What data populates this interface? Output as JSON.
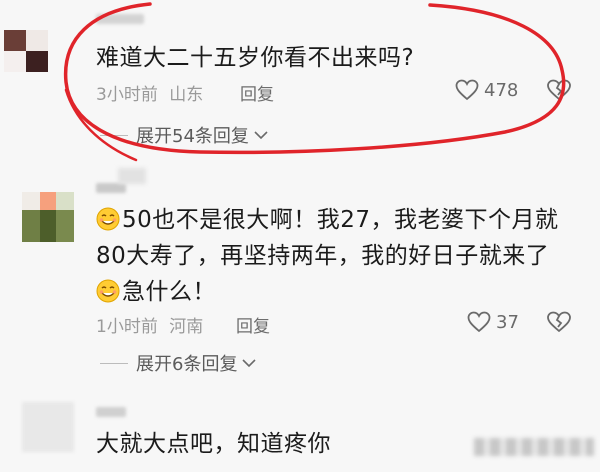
{
  "colors": {
    "background": "#f7f7f7",
    "annotation_circle": "#e0242a",
    "text": "#1b1b1b",
    "meta": "#9a9a9a"
  },
  "comments": [
    {
      "lines": [
        "难道大二十五岁你看不出来吗?"
      ],
      "time": "3小时前",
      "location": "山东",
      "reply_label": "回复",
      "likes": "478",
      "expand_label": "展开54条回复"
    },
    {
      "lines": [
        "50也不是很大啊！我27，我老婆下个月就",
        "80大寿了，再坚持两年，我的好日子就来了",
        "急什么！"
      ],
      "emoji": [
        "smile-emoji",
        "smile-emoji"
      ],
      "time": "1小时前",
      "location": "河南",
      "reply_label": "回复",
      "likes": "37",
      "expand_label": "展开6条回复"
    },
    {
      "lines": [
        "大就大点吧，知道疼你"
      ]
    }
  ],
  "icons": [
    "heart-icon",
    "broken-heart-icon",
    "chevron-down-icon",
    "smile-emoji"
  ]
}
